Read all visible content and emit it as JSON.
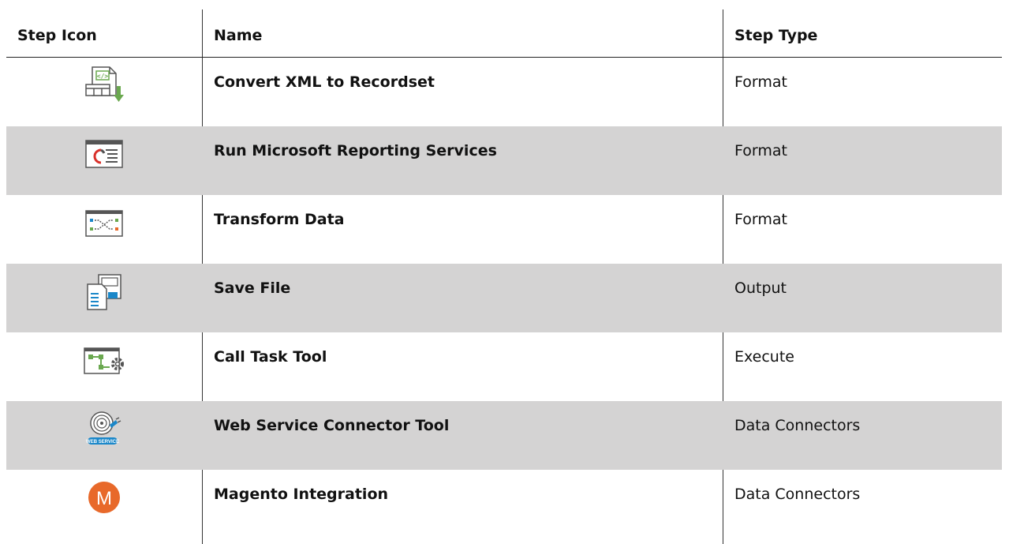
{
  "table": {
    "headers": {
      "icon": "Step Icon",
      "name": "Name",
      "type": "Step Type"
    },
    "rows": [
      {
        "icon": "convert-xml-to-recordset-icon",
        "name": "Convert XML to Recordset",
        "type": "Format"
      },
      {
        "icon": "reporting-services-icon",
        "name": "Run Microsoft Reporting Services",
        "type": "Format"
      },
      {
        "icon": "transform-data-icon",
        "name": "Transform Data",
        "type": "Format"
      },
      {
        "icon": "save-file-icon",
        "name": "Save File",
        "type": "Output"
      },
      {
        "icon": "call-task-tool-icon",
        "name": "Call Task Tool",
        "type": "Execute"
      },
      {
        "icon": "web-service-connector-icon",
        "name": "Web Service Connector Tool",
        "type": "Data Connectors",
        "icon_text": "WEB SERVICE"
      },
      {
        "icon": "magento-icon",
        "name": "Magento Integration",
        "type": "Data Connectors",
        "icon_text": "M"
      }
    ]
  },
  "colors": {
    "row_shade": "#d4d3d3",
    "green": "#6aa84f",
    "blue": "#1a87c9",
    "orange": "#e8692a",
    "red": "#d9312b"
  }
}
